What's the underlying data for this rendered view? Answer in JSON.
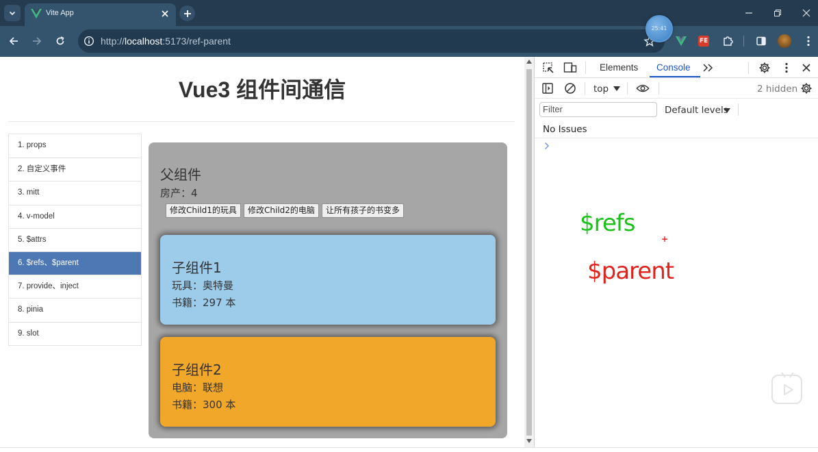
{
  "browser": {
    "tab_title": "Vite App",
    "url_scheme": "http://",
    "url_host": "localhost",
    "url_path": ":5173/ref-parent",
    "timer_badge": "25:41",
    "colors": {
      "chrome_dark": "#243b50",
      "chrome_toolbar": "#34536d",
      "vue_green": "#42b883"
    }
  },
  "app": {
    "title": "Vue3 组件间通信",
    "nav": [
      {
        "label": "1. props",
        "active": false
      },
      {
        "label": "2. 自定义事件",
        "active": false
      },
      {
        "label": "3. mitt",
        "active": false
      },
      {
        "label": "4. v-model",
        "active": false
      },
      {
        "label": "5. $attrs",
        "active": false
      },
      {
        "label": "6. $refs、$parent",
        "active": true
      },
      {
        "label": "7. provide、inject",
        "active": false
      },
      {
        "label": "8. pinia",
        "active": false
      },
      {
        "label": "9. slot",
        "active": false
      }
    ],
    "parent": {
      "heading": "父组件",
      "house": "房产：4",
      "buttons": [
        "修改Child1的玩具",
        "修改Child2的电脑",
        "让所有孩子的书变多"
      ]
    },
    "child1": {
      "heading": "子组件1",
      "toy": "玩具：奥特曼",
      "books": "书籍：297 本",
      "color": "#9dcbea"
    },
    "child2": {
      "heading": "子组件2",
      "computer": "电脑：联想",
      "books": "书籍：300 本",
      "color": "#f0a72a"
    },
    "colors": {
      "active_nav": "#4d78b3",
      "parent_panel": "#a6a6a6"
    }
  },
  "devtools": {
    "tabs": [
      "Elements",
      "Console"
    ],
    "active_tab": "Console",
    "context": "top",
    "hidden_count": "2 hidden",
    "filter_placeholder": "Filter",
    "levels": "Default levels",
    "issues": "No Issues",
    "accent": "#1a55c9"
  },
  "overlay": {
    "refs": "$refs",
    "plus": "+",
    "parent": "$parent",
    "refs_color": "#19c219",
    "parent_color": "#e0231c"
  }
}
